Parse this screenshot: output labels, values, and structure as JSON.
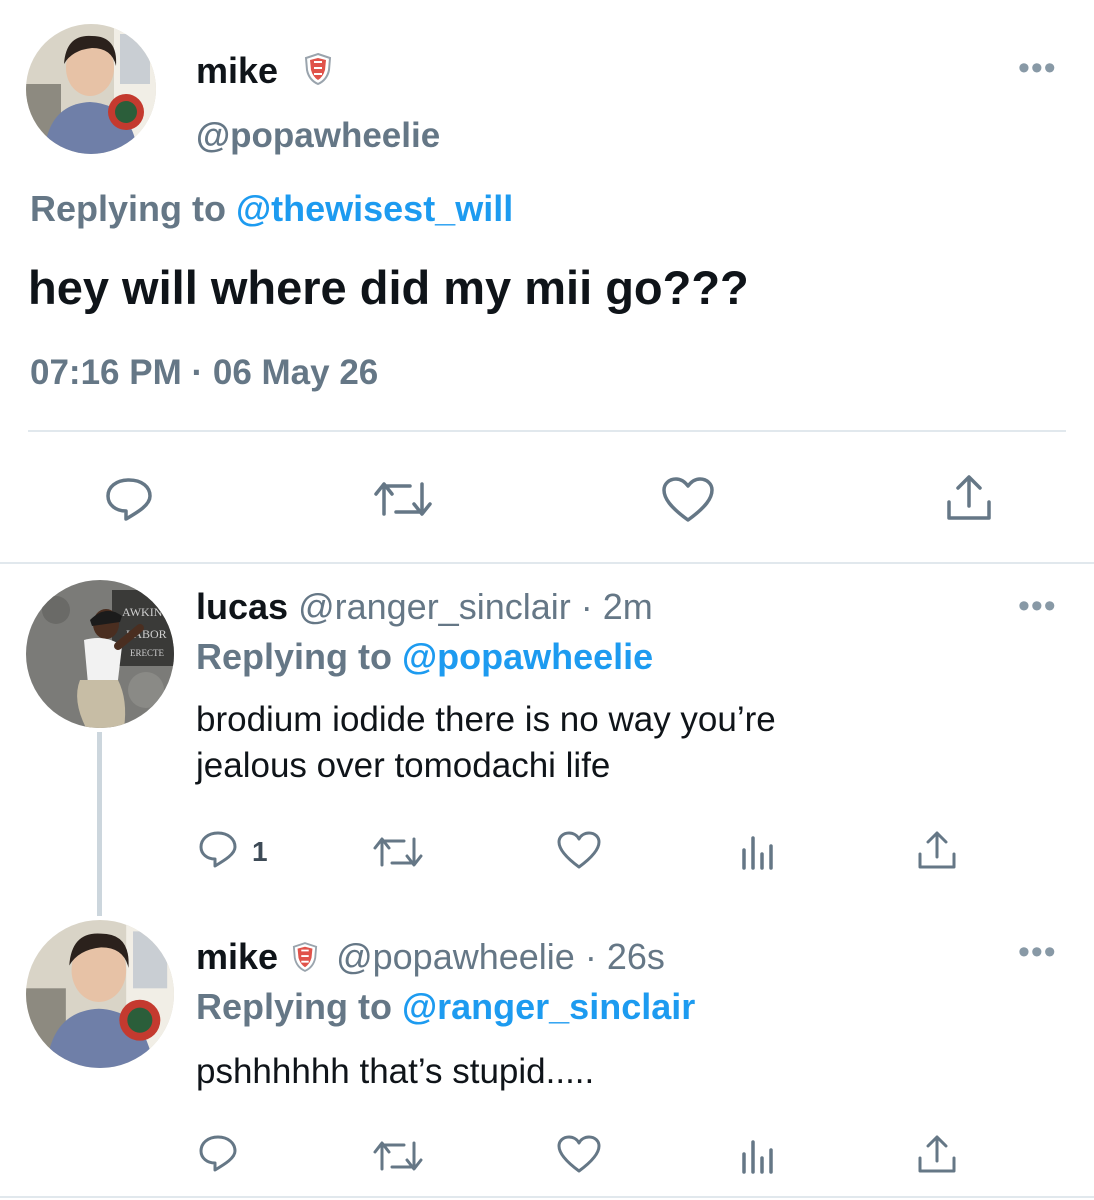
{
  "main_tweet": {
    "display_name": "mike",
    "handle": "@popawheelie",
    "replying_prefix": "Replying to",
    "replying_to": "@thewisest_will",
    "text": "hey will where did my mii go???",
    "time": "07:16 PM",
    "date": "06 May 26",
    "badge_icon": "shield-badge-icon",
    "actions": [
      "reply-icon",
      "retweet-icon",
      "like-icon",
      "share-icon"
    ]
  },
  "replies": [
    {
      "display_name": "lucas",
      "handle": "@ranger_sinclair",
      "age": "2m",
      "replying_prefix": "Replying to",
      "replying_to": "@popawheelie",
      "text_line1": "brodium iodide there is no way you’re",
      "text_line2": "jealous over tomodachi life",
      "reply_count": "1",
      "avatar_sign": [
        "AWKINS",
        "LABOR",
        "ERECTE"
      ]
    },
    {
      "display_name": "mike",
      "handle": "@popawheelie",
      "age": "26s",
      "replying_prefix": "Replying to",
      "replying_to": "@ranger_sinclair",
      "text_line1": "pshhhhhh that’s stupid.....",
      "reply_count": ""
    }
  ],
  "separator": "·",
  "more_label": "•••",
  "colors": {
    "link": "#1d9bf0",
    "muted": "#657786",
    "text": "#0f1419",
    "divider": "#e1e8ed"
  }
}
